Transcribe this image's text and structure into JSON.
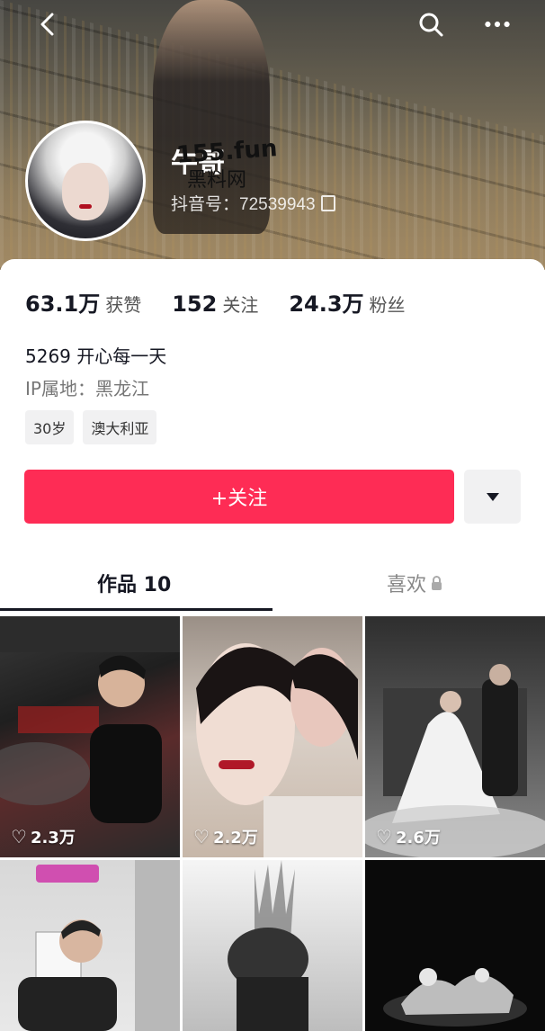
{
  "header": {
    "nickname": "牛哥",
    "douyin_id": "抖音号：72539943",
    "watermark_line1": "155.fun",
    "watermark_line2": "黑料网",
    "back_icon": "back-icon",
    "search_icon": "search-icon",
    "more_icon": "more-icon"
  },
  "stats": {
    "likes_num": "63.1万",
    "likes_label": "获赞",
    "following_num": "152",
    "following_label": "关注",
    "fans_num": "24.3万",
    "fans_label": "粉丝"
  },
  "profile": {
    "bio": "5269 开心每一天",
    "ip": "IP属地：黑龙江",
    "tags": [
      "30岁",
      "澳大利亚"
    ]
  },
  "actions": {
    "follow_label": "+关注",
    "more_icon": "dropdown-triangle-icon"
  },
  "tabs": {
    "works": "作品 10",
    "likes": "喜欢"
  },
  "videos": [
    {
      "likes": "2.3万"
    },
    {
      "likes": "2.2万"
    },
    {
      "likes": "2.6万"
    },
    {
      "likes": ""
    },
    {
      "likes": ""
    },
    {
      "likes": ""
    }
  ],
  "colors": {
    "accent": "#fe2c55",
    "text": "#161823"
  }
}
